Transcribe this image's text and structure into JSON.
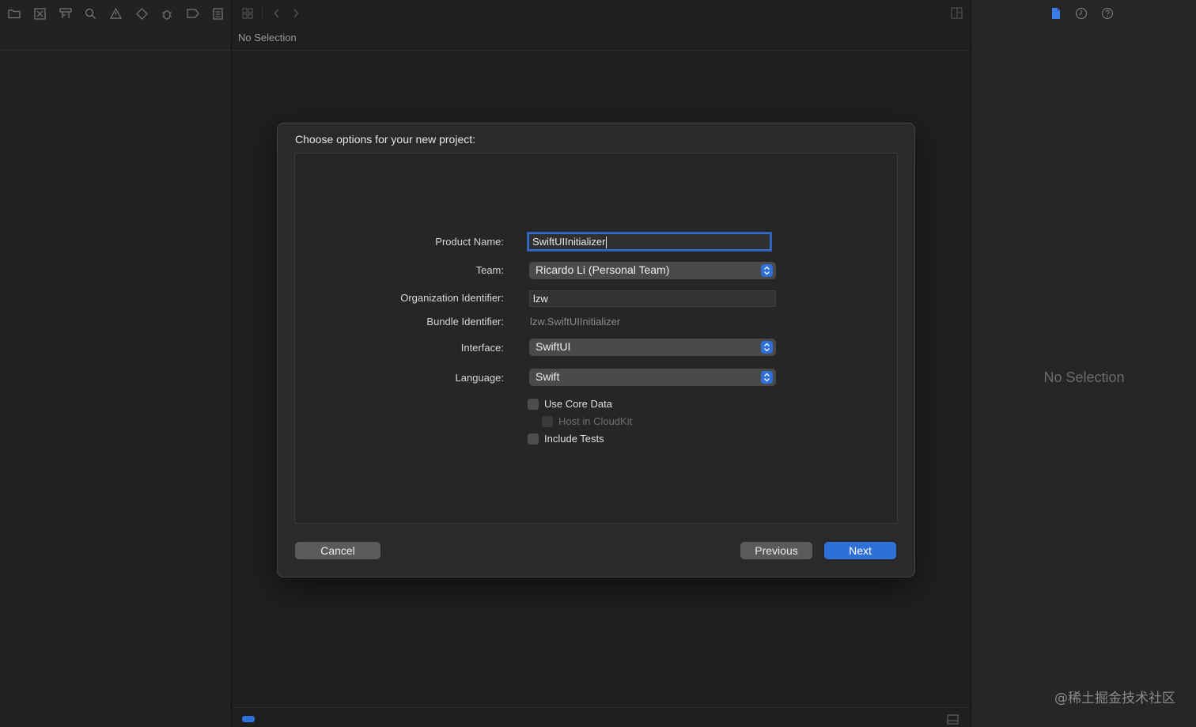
{
  "navigator": {
    "toolbar_icons": [
      "folder-icon",
      "source-control-icon",
      "symbol-icon",
      "search-icon",
      "warning-icon",
      "test-diamond-icon",
      "debug-icon",
      "breakpoint-icon",
      "report-icon"
    ]
  },
  "editor": {
    "title": "No Selection",
    "toolbar_icons": [
      "grid-icon",
      "back-chevron-icon",
      "forward-chevron-icon"
    ]
  },
  "inspector": {
    "empty_text": "No Selection",
    "toolbar_icons": [
      "file-inspector-icon",
      "history-icon",
      "help-icon"
    ],
    "active_icon_color": "#3b7ce8"
  },
  "dialog": {
    "title": "Choose options for your new project:",
    "fields": {
      "product_name": {
        "label": "Product Name:",
        "value": "SwiftUIInitializer"
      },
      "team": {
        "label": "Team:",
        "value": "Ricardo Li (Personal Team)"
      },
      "org_identifier": {
        "label": "Organization Identifier:",
        "value": "lzw"
      },
      "bundle_identifier": {
        "label": "Bundle Identifier:",
        "value": "lzw.SwiftUIInitializer"
      },
      "interface": {
        "label": "Interface:",
        "value": "SwiftUI"
      },
      "language": {
        "label": "Language:",
        "value": "Swift"
      }
    },
    "options": {
      "use_core_data": {
        "label": "Use Core Data",
        "checked": false
      },
      "host_in_cloudkit": {
        "label": "Host in CloudKit",
        "checked": false,
        "enabled": false
      },
      "include_tests": {
        "label": "Include Tests",
        "checked": false
      }
    },
    "buttons": {
      "cancel": "Cancel",
      "previous": "Previous",
      "next": "Next"
    },
    "accent_color": "#2f6fd8"
  },
  "watermark": "@稀土掘金技术社区"
}
